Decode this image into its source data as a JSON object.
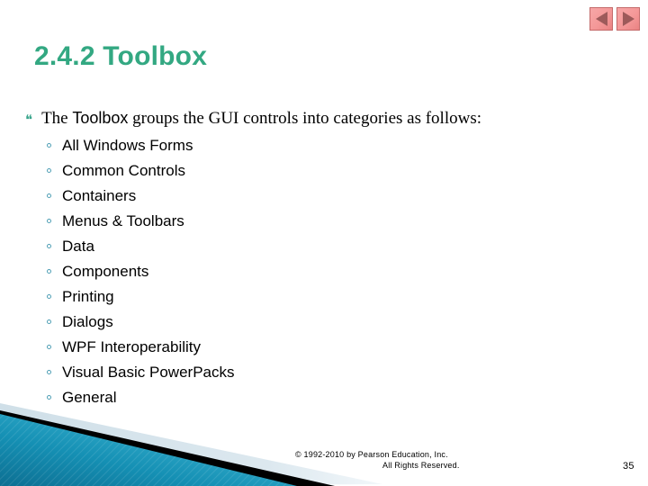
{
  "slide": {
    "title": "2.4.2 Toolbox",
    "page_number": "35",
    "title_color": "#33a882",
    "accent_color": "#1f8fb0",
    "bullet_color": "#3aa58c"
  },
  "nav": {
    "prev_icon": "triangle-left-icon",
    "next_icon": "triangle-right-icon",
    "prev_label": "Previous slide",
    "next_label": "Next slide",
    "button_color": "#f49898"
  },
  "lead": {
    "bullet_glyph": "❝",
    "part1": "The ",
    "emphasis": "Toolbox",
    "part2": " groups the GUI controls into categories as follows:"
  },
  "categories": [
    {
      "label": "All Windows Forms"
    },
    {
      "label": "Common Controls"
    },
    {
      "label": "Containers"
    },
    {
      "label": "Menus & Toolbars"
    },
    {
      "label": "Data"
    },
    {
      "label": "Components"
    },
    {
      "label": "Printing"
    },
    {
      "label": "Dialogs"
    },
    {
      "label": "WPF Interoperability"
    },
    {
      "label": "Visual Basic PowerPacks"
    },
    {
      "label": "General"
    }
  ],
  "footer": {
    "copyright": "© 1992-2010 by Pearson Education, Inc.",
    "rights": "All Rights Reserved."
  }
}
